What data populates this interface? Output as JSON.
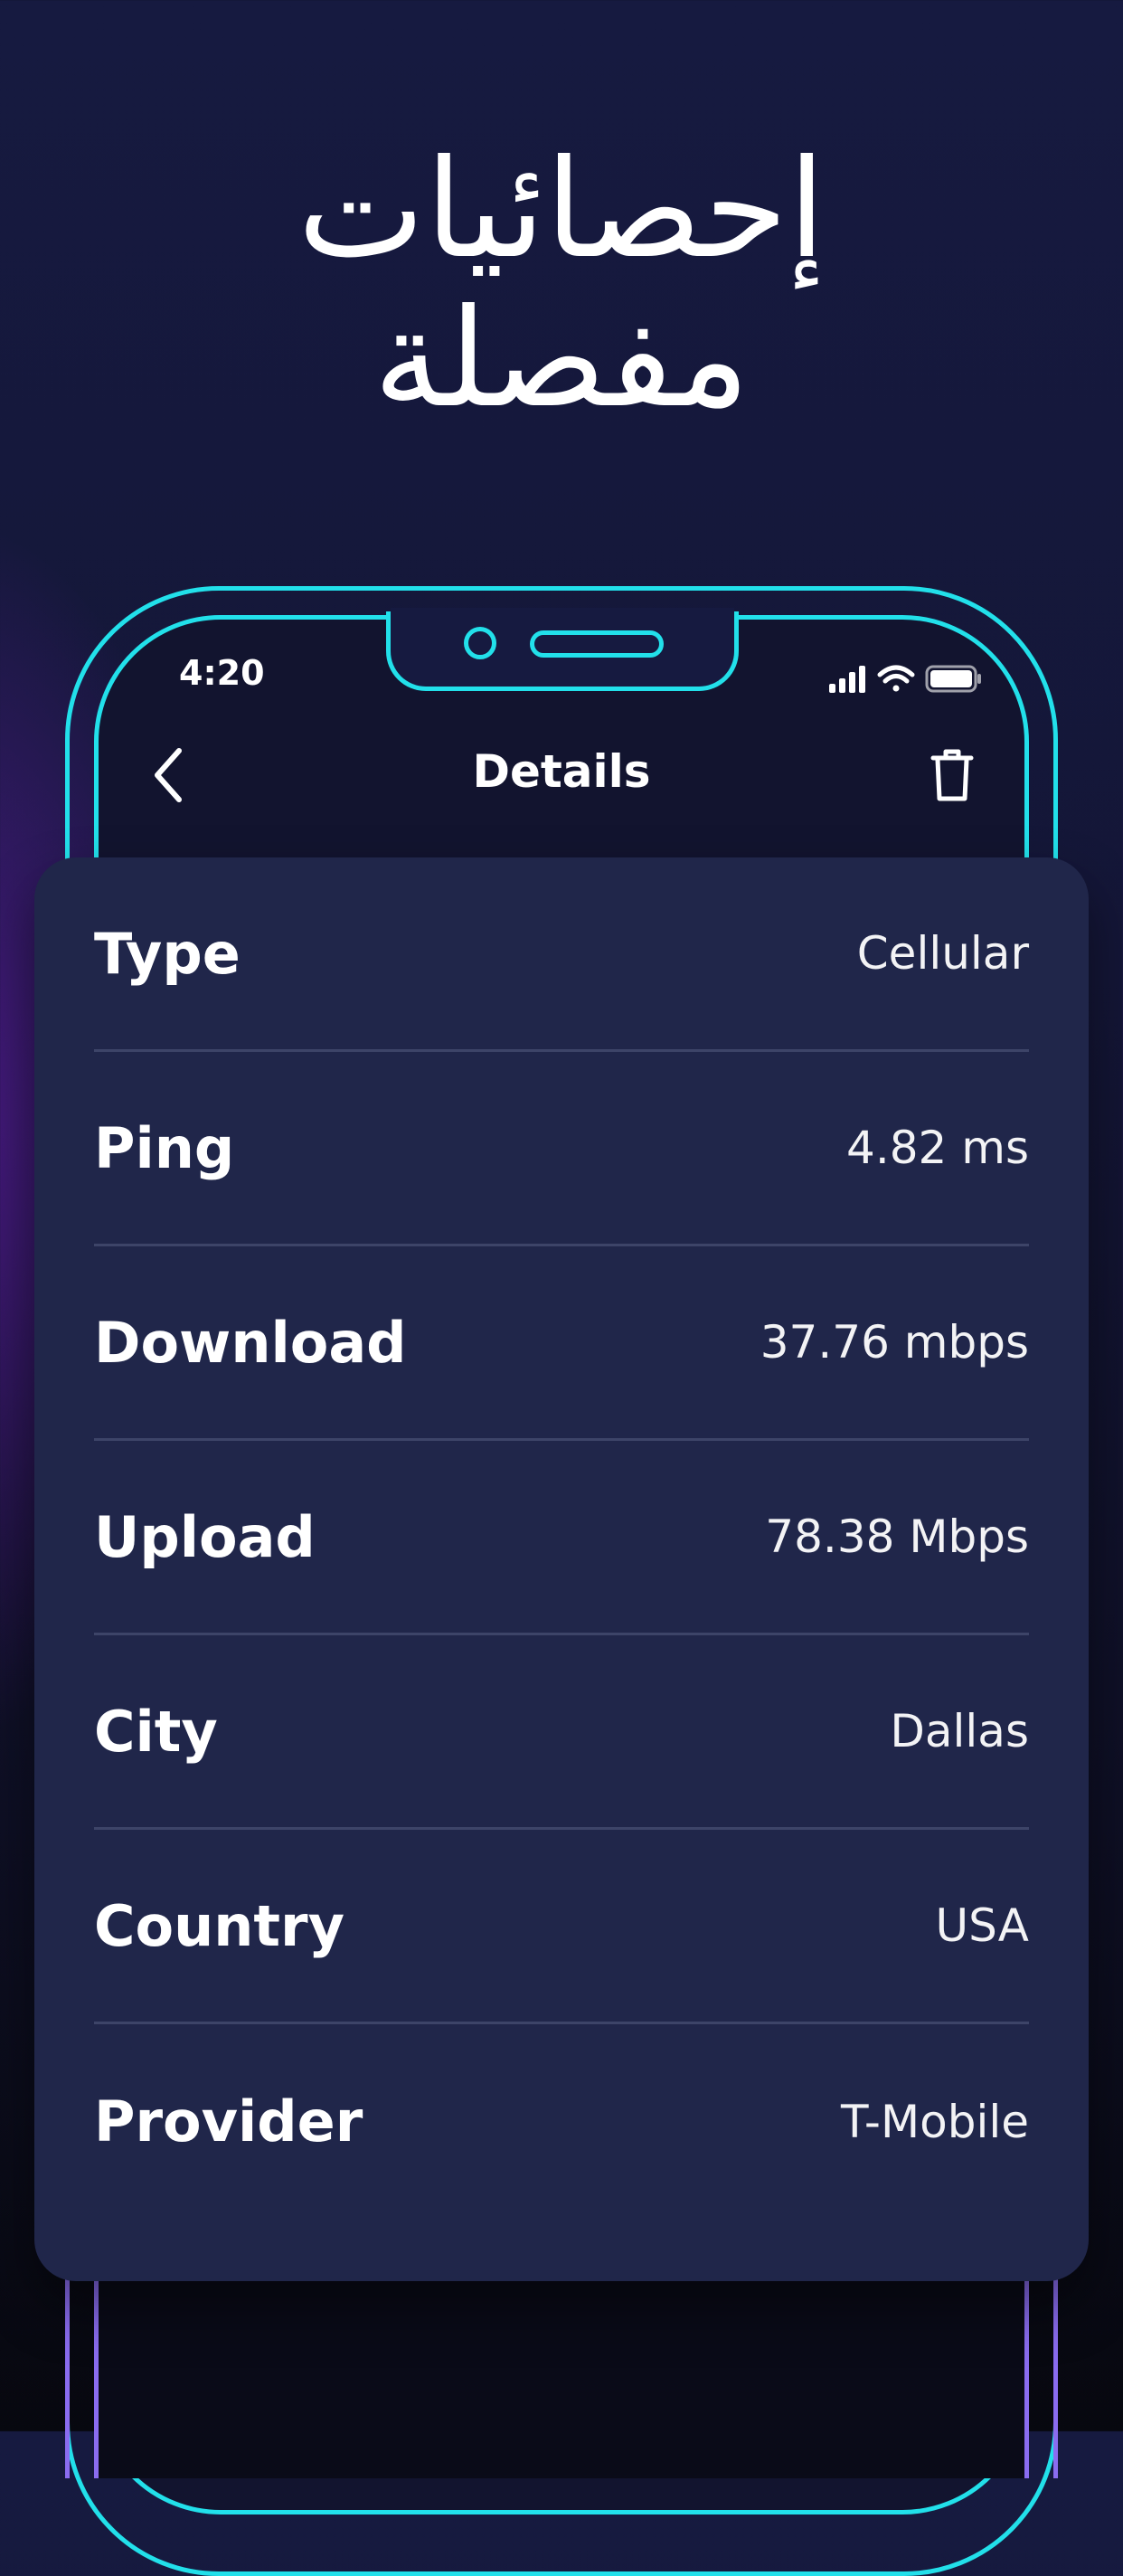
{
  "headline": {
    "line1": "إحصائيات",
    "line2": "مفصلة"
  },
  "status_bar": {
    "time": "4:20",
    "icons": [
      "signal-icon",
      "wifi-icon",
      "battery-icon"
    ]
  },
  "nav": {
    "title": "Details",
    "back_icon": "chevron-left-icon",
    "action_icon": "trash-icon"
  },
  "details": [
    {
      "label": "Type",
      "value": "Cellular"
    },
    {
      "label": "Ping",
      "value": "4.82 ms"
    },
    {
      "label": "Download",
      "value": "37.76 mbps"
    },
    {
      "label": "Upload",
      "value": "78.38 Mbps"
    },
    {
      "label": "City",
      "value": "Dallas"
    },
    {
      "label": "Country",
      "value": "USA"
    },
    {
      "label": "Provider",
      "value": "T-Mobile"
    }
  ],
  "colors": {
    "accent_cyan": "#22e0ea",
    "accent_purple": "#8a6cf0",
    "card_bg": "#20264a",
    "divider": "#3d4468"
  }
}
